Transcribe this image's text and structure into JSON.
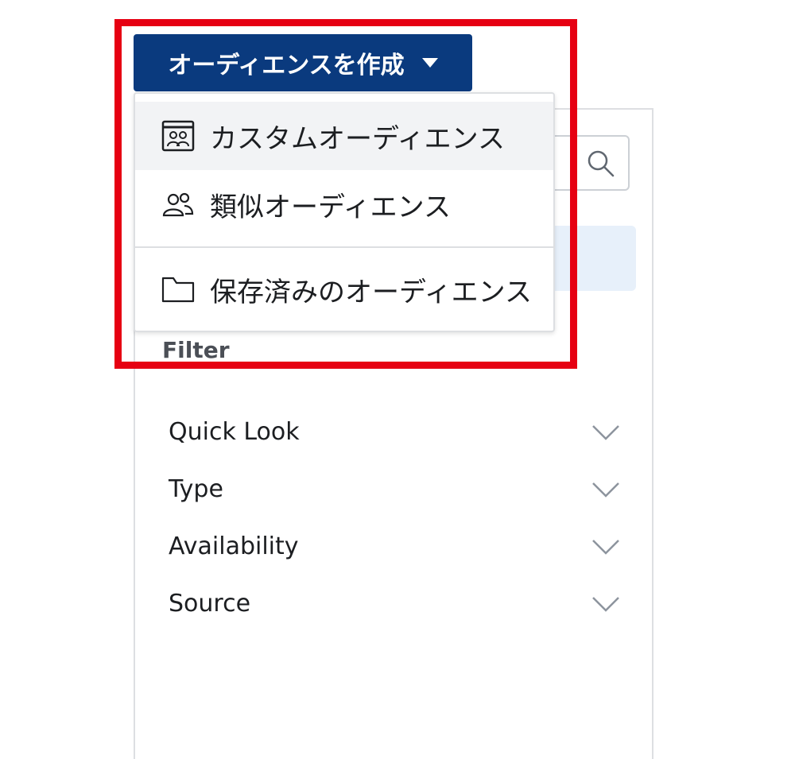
{
  "create_button": {
    "label": "オーディエンスを作成",
    "icon": "caret-down-icon"
  },
  "menu": {
    "items": [
      {
        "label": "カスタムオーディエンス",
        "icon": "custom-audience-icon",
        "active": true
      },
      {
        "label": "類似オーディエンス",
        "icon": "people-icon",
        "active": false
      },
      {
        "label": "保存済みのオーディエンス",
        "icon": "folder-icon",
        "active": false
      }
    ]
  },
  "panel": {
    "search_icon": "search-icon",
    "filter_heading": "Filter",
    "filters": [
      {
        "label": "Quick Look",
        "icon": "chevron-down-icon"
      },
      {
        "label": "Type",
        "icon": "chevron-down-icon"
      },
      {
        "label": "Availability",
        "icon": "chevron-down-icon"
      },
      {
        "label": "Source",
        "icon": "chevron-down-icon"
      }
    ]
  },
  "colors": {
    "button_bg": "#0a3a7e",
    "annotation_red": "#e60012",
    "active_item_bg": "#f2f3f5",
    "highlight_bg": "#e7f0fa"
  }
}
